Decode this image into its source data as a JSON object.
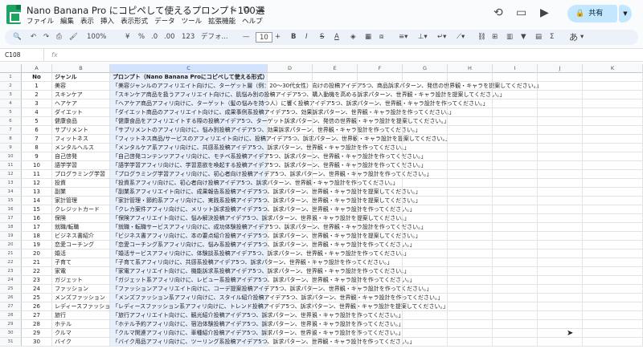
{
  "document": {
    "title": "Nano Banana Pro にコピペして使えるプロンプト100選"
  },
  "title_icons": [
    "star-icon",
    "move-icon",
    "cloud-icon"
  ],
  "menu": [
    "ファイル",
    "編集",
    "表示",
    "挿入",
    "表示形式",
    "データ",
    "ツール",
    "拡張機能",
    "ヘルプ"
  ],
  "share": {
    "label": "共有"
  },
  "toolbar": {
    "search": "🔍",
    "undo": "↶",
    "redo": "↷",
    "print": "⎙",
    "paint": "🖌",
    "zoom": "100%",
    "currency": "¥",
    "percent": "%",
    "dec_minus": ".0",
    "dec_plus": ".00",
    "num123": "123",
    "font": "デフォ...",
    "font_size": "10",
    "bold": "B",
    "italic": "I",
    "strike": "S",
    "textcolor": "A",
    "input_tools": "あ"
  },
  "formula_bar": {
    "cell_ref": "C108",
    "fx": "fx"
  },
  "columns": [
    "A",
    "B",
    "C",
    "D",
    "E",
    "F",
    "G",
    "H",
    "I",
    "J",
    "K"
  ],
  "header_row": {
    "no": "No",
    "genre": "ジャンル",
    "prompt": "プロンプト（Nano Banana Proにコピペして使える形式）"
  },
  "rows": [
    {
      "no": "1",
      "genre": "美容",
      "prompt": "「美容ジャンルのアフィリエイト向けに、ターゲット層（例：20〜30代女性）向けの投稿アイデア5つ、商品訴求パターン、発信の世界観・キャラを提案してください。」"
    },
    {
      "no": "2",
      "genre": "スキンケア",
      "prompt": "「スキンケア商品を扱うアフィリエイト向けに、肌悩み別の投稿アイデア5つ、購入動機を高める訴求パターン、世界観・キャラ設計を提案してください。」"
    },
    {
      "no": "3",
      "genre": "ヘアケア",
      "prompt": "「ヘアケア商品アフィリ向けに、ターゲット（髪の悩みを持つ人）に響く投稿アイデア5つ、訴求パターン、世界観・キャラ設計を作ってください。」"
    },
    {
      "no": "4",
      "genre": "ダイエット",
      "prompt": "「ダイエット商品のアフィリエイト向けに、成果事例系投稿アイデア5つ、効果訴求パターン、世界観・キャラ設計を作ってください。」"
    },
    {
      "no": "5",
      "genre": "健康食品",
      "prompt": "「健康食品をアフィリエイトする際の投稿アイデア5つ、ターゲット訴求パターン、発信の世界観・キャラ設計を提案してください。」"
    },
    {
      "no": "6",
      "genre": "サプリメント",
      "prompt": "「サプリメントのアフィリ向けに、悩み別投稿アイデア5つ、効果訴求パターン、世界観・キャラ設計を作ってください。」"
    },
    {
      "no": "7",
      "genre": "フィットネス",
      "prompt": "「フィットネス商品/サービスのアフィリエイト向けに、投稿アイデア5つ、訴求パターン、世界観・キャラ設計を提案してください。」"
    },
    {
      "no": "8",
      "genre": "メンタルヘルス",
      "prompt": "「メンタルケア系アフィリ向けに、共感系投稿アイデア5つ、訴求パターン、世界観・キャラ設計を作ってください。」"
    },
    {
      "no": "9",
      "genre": "自己啓発",
      "prompt": "「自己啓発コンテンツアフィリ向けに、モチベ系投稿アイデア5つ、訴求パターン、世界観・キャラ設計を作ってください。」"
    },
    {
      "no": "10",
      "genre": "語学学習",
      "prompt": "「語学学習アフィリ向けに、学習意欲を喚起する投稿アイデア5つ、訴求パターン、世界観・キャラ設計を作ってください。」"
    },
    {
      "no": "11",
      "genre": "プログラミング学習",
      "prompt": "「プログラミング学習アフィリ向けに、初心者向け投稿アイデア5つ、訴求パターン、世界観・キャラ設計を作ってください。」"
    },
    {
      "no": "12",
      "genre": "投資",
      "prompt": "「投資系アフィリ向けに、初心者向け投稿アイデア5つ、訴求パターン、世界観・キャラ設計を作ってください。」"
    },
    {
      "no": "13",
      "genre": "副業",
      "prompt": "「副業系アフィリエイト向けに、成果報告系投稿アイデア5つ、訴求パターン、世界観・キャラ設計を提案してください。」"
    },
    {
      "no": "14",
      "genre": "家計管理",
      "prompt": "「家計管理・節約系アフィリ向けに、実践系投稿アイデア5つ、訴求パターン、世界観・キャラ設計を提案してください。」"
    },
    {
      "no": "15",
      "genre": "クレジットカード",
      "prompt": "「クレカ案件アフィリ向けに、メリット訴求投稿アイデア5つ、訴求パターン、世界観・キャラ設計を作ってください。」"
    },
    {
      "no": "16",
      "genre": "保険",
      "prompt": "「保険アフィリエイト向けに、悩み解決投稿アイデア5つ、訴求パターン、世界観・キャラ設計を提案してください。」"
    },
    {
      "no": "17",
      "genre": "就職/転職",
      "prompt": "「就職・転職サービスアフィリ向けに、成功体験投稿アイデア5つ、訴求パターン、世界観・キャラ設計を作ってください。」"
    },
    {
      "no": "18",
      "genre": "ビジネス書紹介",
      "prompt": "「ビジネス書アフィリ向けに、本の要点紹介投稿アイデア5つ、訴求パターン、世界観・キャラ設計を提案してください。」"
    },
    {
      "no": "19",
      "genre": "恋愛コーチング",
      "prompt": "「恋愛コーチング系アフィリ向けに、悩み系投稿アイデア5つ、訴求パターン、世界観・キャラ設計を作ってください。」"
    },
    {
      "no": "20",
      "genre": "婚活",
      "prompt": "「婚活サービスアフィリ向けに、体験談系投稿アイデア5つ、訴求パターン、世界観・キャラ設計を作ってください。」"
    },
    {
      "no": "21",
      "genre": "子育て",
      "prompt": "「子育て系アフィリ向けに、共感系投稿アイデア5つ、訴求パターン、世界観・キャラ設計を作ってください。」"
    },
    {
      "no": "22",
      "genre": "家電",
      "prompt": "「家電アフィリエイト向けに、機能訴求系投稿アイデア5つ、訴求パターン、世界観・キャラ設計を作ってください。」"
    },
    {
      "no": "23",
      "genre": "ガジェット",
      "prompt": "「ガジェット系アフィリ向けに、レビュー系投稿アイデア5つ、訴求パターン、世界観・キャラ設計を作ってください。」"
    },
    {
      "no": "24",
      "genre": "ファッション",
      "prompt": "「ファッションアフィリエイト向けに、コーデ提案投稿アイデア5つ、訴求パターン、世界観・キャラ設計を作ってください。」"
    },
    {
      "no": "25",
      "genre": "メンズファッション",
      "prompt": "「メンズファッション系アフィリ向けに、スタイル紹介投稿アイデア5つ、訴求パターン、世界観・キャラ設計を作ってください。」"
    },
    {
      "no": "26",
      "genre": "レディースファッション",
      "prompt": "「レディースファッション系アフィリ向けに、トレンド投稿アイデア5つ、訴求パターン、世界観・キャラ設計を提案してください。」"
    },
    {
      "no": "27",
      "genre": "旅行",
      "prompt": "「旅行アフィリエイト向けに、観光紹介投稿アイデア5つ、訴求パターン、世界観・キャラ設計を作ってください。」"
    },
    {
      "no": "28",
      "genre": "ホテル",
      "prompt": "「ホテル予約アフィリ向けに、宿泊体験投稿アイデア5つ、訴求パターン、世界観・キャラ設計を作ってください。」"
    },
    {
      "no": "29",
      "genre": "クルマ",
      "prompt": "「クルマ関連アフィリ向けに、車種紹介投稿アイデア5つ、訴求パターン、世界観・キャラ設計を作ってください。」"
    },
    {
      "no": "30",
      "genre": "バイク",
      "prompt": "「バイク用品アフィリ向けに、ツーリング系投稿アイデア5つ、訴求パターン、世界観・キャラ設計を作ってください。」"
    }
  ]
}
